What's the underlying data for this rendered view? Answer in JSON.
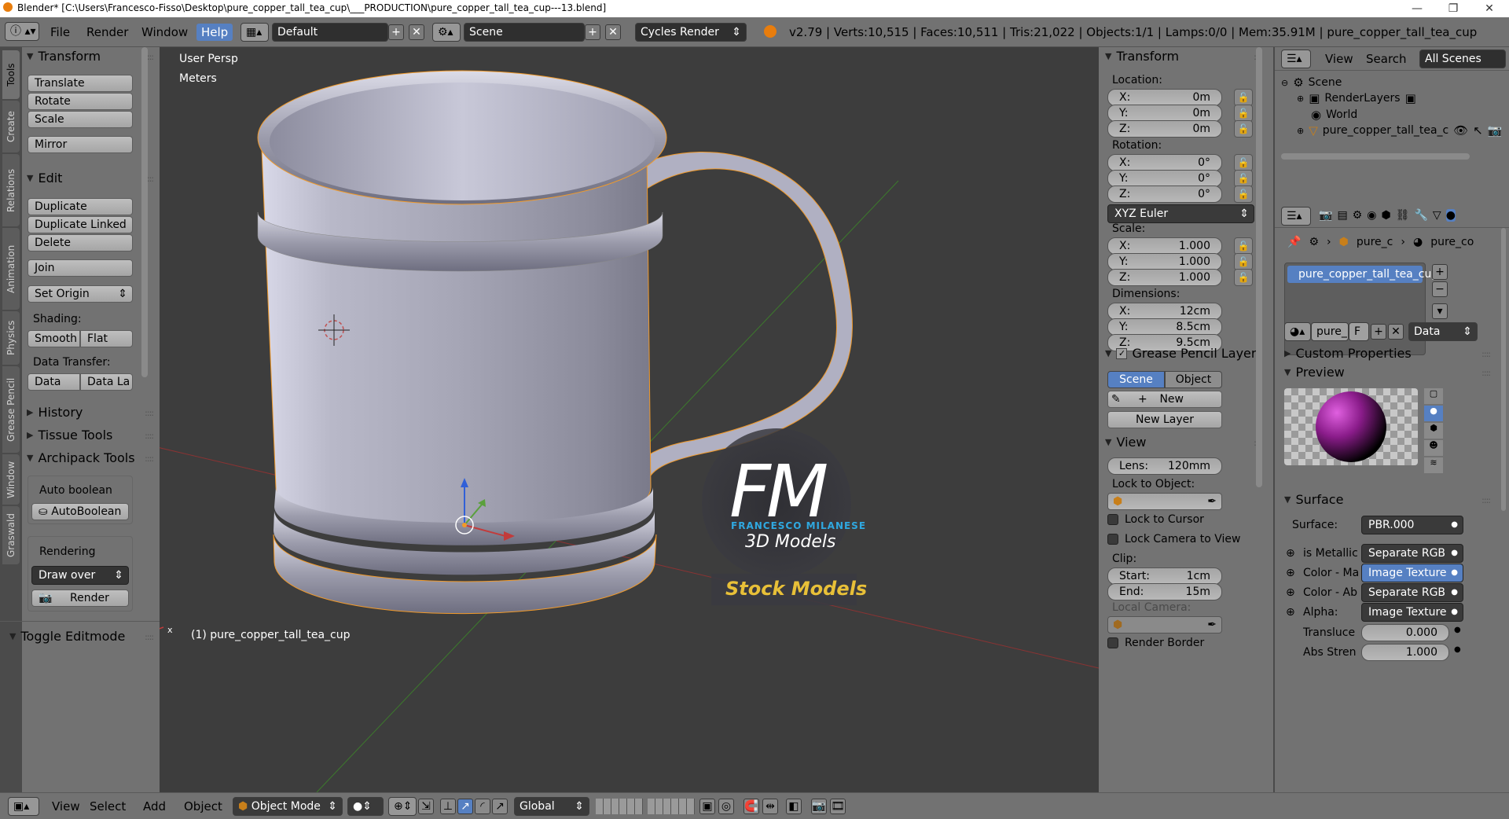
{
  "window": {
    "title": "Blender* [C:\\Users\\Francesco-Fisso\\Desktop\\pure_copper_tall_tea_cup\\___PRODUCTION\\pure_copper_tall_tea_cup---13.blend]",
    "min_icon": "minimize-icon",
    "max_icon": "maximize-icon",
    "close_icon": "close-icon"
  },
  "topbar": {
    "menus": [
      "File",
      "Render",
      "Window",
      "Help"
    ],
    "layout": "Default",
    "scene": "Scene",
    "engine": "Cycles Render",
    "stats": "v2.79 | Verts:10,515 | Faces:10,511 | Tris:21,022 | Objects:1/1 | Lamps:0/0 | Mem:35.91M | pure_copper_tall_tea_cup"
  },
  "tabs": [
    "Tools",
    "Create",
    "Relations",
    "Animation",
    "Physics",
    "Grease Pencil",
    "Window",
    "Graswald"
  ],
  "toolshelf": {
    "transform": {
      "title": "Transform",
      "buttons": [
        "Translate",
        "Rotate",
        "Scale",
        "Mirror"
      ]
    },
    "edit": {
      "title": "Edit",
      "buttons": [
        "Duplicate",
        "Duplicate Linked",
        "Delete",
        "Join"
      ],
      "set_origin": "Set Origin",
      "shading_label": "Shading:",
      "smooth": "Smooth",
      "flat": "Flat",
      "data_transfer_label": "Data Transfer:",
      "data": "Data",
      "data_la": "Data La"
    },
    "history": "History",
    "tissue": "Tissue Tools",
    "archipack": "Archipack Tools",
    "auto_boolean_label": "Auto boolean",
    "auto_boolean_btn": "AutoBoolean",
    "rendering_label": "Rendering",
    "draw_over": "Draw over",
    "render_btn": "Render",
    "toggle_editmode": "Toggle Editmode"
  },
  "viewport": {
    "persp": "User Persp",
    "units": "Meters",
    "object_label": "(1) pure_copper_tall_tea_cup",
    "watermark": {
      "fm": "FM",
      "name": "FRANCESCO MILANESE",
      "sub": "3D Models",
      "stock": "Stock Models"
    },
    "colors": {
      "x_axis": "#c23b3b",
      "y_axis": "#5aa03c",
      "z_axis": "#3160d8",
      "selection": "#f19a2a"
    }
  },
  "bottombar": {
    "menus": [
      "View",
      "Select",
      "Add",
      "Object"
    ],
    "mode": "Object Mode",
    "orientation": "Global"
  },
  "npanel": {
    "transform_title": "Transform",
    "location_label": "Location:",
    "location": [
      {
        "k": "X:",
        "v": "0m"
      },
      {
        "k": "Y:",
        "v": "0m"
      },
      {
        "k": "Z:",
        "v": "0m"
      }
    ],
    "rotation_label": "Rotation:",
    "rotation": [
      {
        "k": "X:",
        "v": "0°"
      },
      {
        "k": "Y:",
        "v": "0°"
      },
      {
        "k": "Z:",
        "v": "0°"
      }
    ],
    "rotation_mode": "XYZ Euler",
    "scale_label": "Scale:",
    "scale": [
      {
        "k": "X:",
        "v": "1.000"
      },
      {
        "k": "Y:",
        "v": "1.000"
      },
      {
        "k": "Z:",
        "v": "1.000"
      }
    ],
    "dimensions_label": "Dimensions:",
    "dimensions": [
      {
        "k": "X:",
        "v": "12cm"
      },
      {
        "k": "Y:",
        "v": "8.5cm"
      },
      {
        "k": "Z:",
        "v": "9.5cm"
      }
    ],
    "grease_title": "Grease Pencil Layer",
    "scene_tab": "Scene",
    "object_tab": "Object",
    "new_btn": "New",
    "new_layer": "New Layer",
    "view_title": "View",
    "lens_k": "Lens:",
    "lens_v": "120mm",
    "lock_to_object": "Lock to Object:",
    "lock_cursor": "Lock to Cursor",
    "lock_camera": "Lock Camera to View",
    "clip_label": "Clip:",
    "clip_start_k": "Start:",
    "clip_start_v": "1cm",
    "clip_end_k": "End:",
    "clip_end_v": "15m",
    "local_camera": "Local Camera:",
    "render_border": "Render Border"
  },
  "outliner": {
    "view": "View",
    "search": "Search",
    "all_scenes": "All Scenes",
    "items": [
      "Scene",
      "RenderLayers",
      "World",
      "pure_copper_tall_tea_c"
    ]
  },
  "properties": {
    "breadcrumb": [
      "pure_c",
      "pure_co"
    ],
    "material_slot": "pure_copper_tall_tea_cup",
    "mat_name": "pure_",
    "mat_f": "F",
    "mat_data": "Data",
    "custom_props": "Custom Properties",
    "preview": "Preview",
    "surface_title": "Surface",
    "surface_label": "Surface:",
    "surface_value": "PBR.000",
    "rows": [
      {
        "k": "is Metallic",
        "v": "Separate RGB"
      },
      {
        "k": "Color - Ma",
        "v": "Image Texture"
      },
      {
        "k": "Color - Ab",
        "v": "Separate RGB"
      },
      {
        "k": "Alpha:",
        "v": "Image Texture"
      }
    ],
    "translucence_k": "Transluce",
    "translucence_v": "0.000",
    "abs_k": "Abs Stren",
    "abs_v": "1.000"
  }
}
